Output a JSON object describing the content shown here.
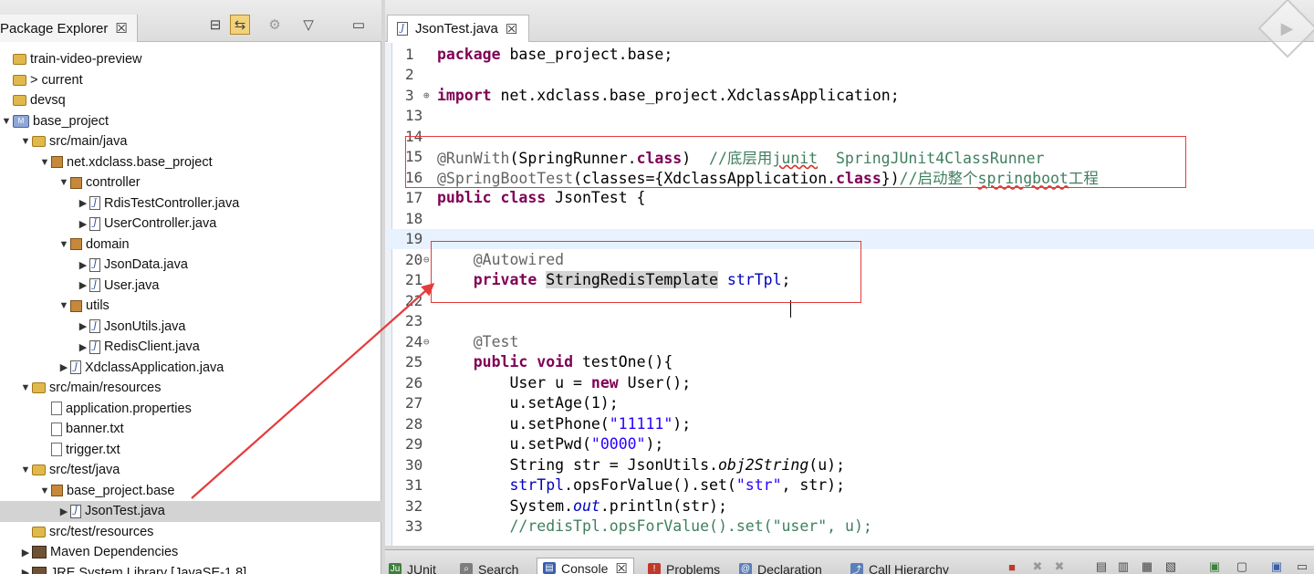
{
  "package_explorer": {
    "title": "Package Explorer",
    "close_glyph": "☒",
    "toolbar": [
      {
        "name": "collapse-all-icon",
        "glyph": "⊟"
      },
      {
        "name": "link-with-editor-icon",
        "glyph": "⇆"
      },
      {
        "name": "focus-icon",
        "glyph": "⚙"
      },
      {
        "name": "view-menu-icon",
        "glyph": "▽"
      },
      {
        "name": "minimize-icon",
        "glyph": "▭"
      }
    ],
    "tree": [
      {
        "indent": 0,
        "twisty": "",
        "icon": "folder",
        "label": "train-video-preview"
      },
      {
        "indent": 0,
        "twisty": "",
        "icon": "folder",
        "label": "> current"
      },
      {
        "indent": 0,
        "twisty": "",
        "icon": "folder",
        "label": "devsq"
      },
      {
        "indent": 0,
        "twisty": "▼",
        "icon": "proj",
        "label": "base_project"
      },
      {
        "indent": 1,
        "twisty": "▼",
        "icon": "folder",
        "label": "src/main/java"
      },
      {
        "indent": 2,
        "twisty": "▼",
        "icon": "pkg",
        "label": "net.xdclass.base_project"
      },
      {
        "indent": 3,
        "twisty": "▼",
        "icon": "pkg",
        "label": "controller"
      },
      {
        "indent": 4,
        "twisty": "▶",
        "icon": "java",
        "label": "RdisTestController.java"
      },
      {
        "indent": 4,
        "twisty": "▶",
        "icon": "java",
        "label": "UserController.java"
      },
      {
        "indent": 3,
        "twisty": "▼",
        "icon": "pkg",
        "label": "domain"
      },
      {
        "indent": 4,
        "twisty": "▶",
        "icon": "java",
        "label": "JsonData.java"
      },
      {
        "indent": 4,
        "twisty": "▶",
        "icon": "java",
        "label": "User.java"
      },
      {
        "indent": 3,
        "twisty": "▼",
        "icon": "pkg",
        "label": "utils"
      },
      {
        "indent": 4,
        "twisty": "▶",
        "icon": "java",
        "label": "JsonUtils.java"
      },
      {
        "indent": 4,
        "twisty": "▶",
        "icon": "java",
        "label": "RedisClient.java"
      },
      {
        "indent": 3,
        "twisty": "▶",
        "icon": "java",
        "label": "XdclassApplication.java"
      },
      {
        "indent": 1,
        "twisty": "▼",
        "icon": "folder",
        "label": "src/main/resources"
      },
      {
        "indent": 2,
        "twisty": "",
        "icon": "file",
        "label": "application.properties"
      },
      {
        "indent": 2,
        "twisty": "",
        "icon": "file",
        "label": "banner.txt"
      },
      {
        "indent": 2,
        "twisty": "",
        "icon": "file",
        "label": "trigger.txt"
      },
      {
        "indent": 1,
        "twisty": "▼",
        "icon": "folder",
        "label": "src/test/java"
      },
      {
        "indent": 2,
        "twisty": "▼",
        "icon": "pkg",
        "label": "base_project.base"
      },
      {
        "indent": 3,
        "twisty": "▶",
        "icon": "java",
        "label": "JsonTest.java",
        "selected": true
      },
      {
        "indent": 1,
        "twisty": "",
        "icon": "folder",
        "label": "src/test/resources"
      },
      {
        "indent": 1,
        "twisty": "▶",
        "icon": "lib",
        "label": "Maven Dependencies"
      },
      {
        "indent": 1,
        "twisty": "▶",
        "icon": "lib",
        "label": "JRE System Library [JavaSE-1.8]"
      }
    ]
  },
  "editor": {
    "tab_label": "JsonTest.java",
    "tab_close": "☒",
    "lines": [
      {
        "n": "1",
        "fold": "",
        "html": "<span class='kw'>package</span> base_project.base;"
      },
      {
        "n": "2",
        "fold": "",
        "html": ""
      },
      {
        "n": "3",
        "fold": "⊕",
        "html": "<span class='kw'>import</span> net.xdclass.base_project.XdclassApplication;"
      },
      {
        "n": "13",
        "fold": "",
        "html": ""
      },
      {
        "n": "14",
        "fold": "",
        "html": ""
      },
      {
        "n": "15",
        "fold": "",
        "html": "<span class='ann'>@RunWith</span>(SpringRunner.<span class='kw'>class</span>)  <span class='cmt'>//底层用<span class='sq'>junit</span>  SpringJUnit4ClassRunner</span>"
      },
      {
        "n": "16",
        "fold": "",
        "html": "<span class='ann'>@SpringBootTest</span>(classes={XdclassApplication.<span class='kw'>class</span>})<span class='cmt'>//启动整个<span class='sq'>springboot</span>工程</span>"
      },
      {
        "n": "17",
        "fold": "",
        "html": "<span class='kw'>public class</span> JsonTest {"
      },
      {
        "n": "18",
        "fold": "",
        "html": ""
      },
      {
        "n": "19",
        "fold": "",
        "html": "",
        "current": true
      },
      {
        "n": "20",
        "fold": "⊖",
        "html": "    <span class='ann'>@Autowired</span>"
      },
      {
        "n": "21",
        "fold": "",
        "html": "    <span class='kw'>private</span> <span class='hl'>StringRedisTemplate</span> <span class='fld'>strTpl</span>;"
      },
      {
        "n": "22",
        "fold": "",
        "html": ""
      },
      {
        "n": "23",
        "fold": "",
        "html": ""
      },
      {
        "n": "24",
        "fold": "⊖",
        "html": "    <span class='ann'>@Test</span>"
      },
      {
        "n": "25",
        "fold": "",
        "html": "    <span class='kw'>public void</span> testOne(){"
      },
      {
        "n": "26",
        "fold": "",
        "html": "        User u = <span class='kw'>new</span> User();"
      },
      {
        "n": "27",
        "fold": "",
        "html": "        u.setAge(1);"
      },
      {
        "n": "28",
        "fold": "",
        "html": "        u.setPhone(<span class='str'>\"11111\"</span>);"
      },
      {
        "n": "29",
        "fold": "",
        "html": "        u.setPwd(<span class='str'>\"0000\"</span>);"
      },
      {
        "n": "30",
        "fold": "",
        "html": "        String str = JsonUtils.<span class='it'>obj2String</span>(u);"
      },
      {
        "n": "31",
        "fold": "",
        "html": "        <span class='fld'>strTpl</span>.opsForValue().set(<span class='str'>\"str\"</span>, str);"
      },
      {
        "n": "32",
        "fold": "",
        "html": "        System.<span class='sfld'>out</span>.println(str);"
      },
      {
        "n": "33",
        "fold": "",
        "html": "        <span class='cmt'>//redisTpl.opsForValue().set(\"user\", u);</span>"
      }
    ]
  },
  "bottom_panel": {
    "tabs": [
      {
        "label": "JUnit",
        "icon_color": "#3f7f3f",
        "icon": "Ju"
      },
      {
        "label": "Search",
        "icon_color": "#7d7d7d",
        "icon": "⌕"
      },
      {
        "label": "Console",
        "icon_color": "#3a5fa8",
        "icon": "▤",
        "active": true
      },
      {
        "label": "Problems",
        "icon_color": "#c0392b",
        "icon": "!"
      },
      {
        "label": "Declaration",
        "icon_color": "#5b7fb8",
        "icon": "@"
      },
      {
        "label": "Call Hierarchy",
        "icon_color": "#5b7fb8",
        "icon": "⤴"
      }
    ],
    "console_close": "☒"
  },
  "colors": {
    "annotation_box": "#e43b3b",
    "arrow": "#e43b3b"
  }
}
